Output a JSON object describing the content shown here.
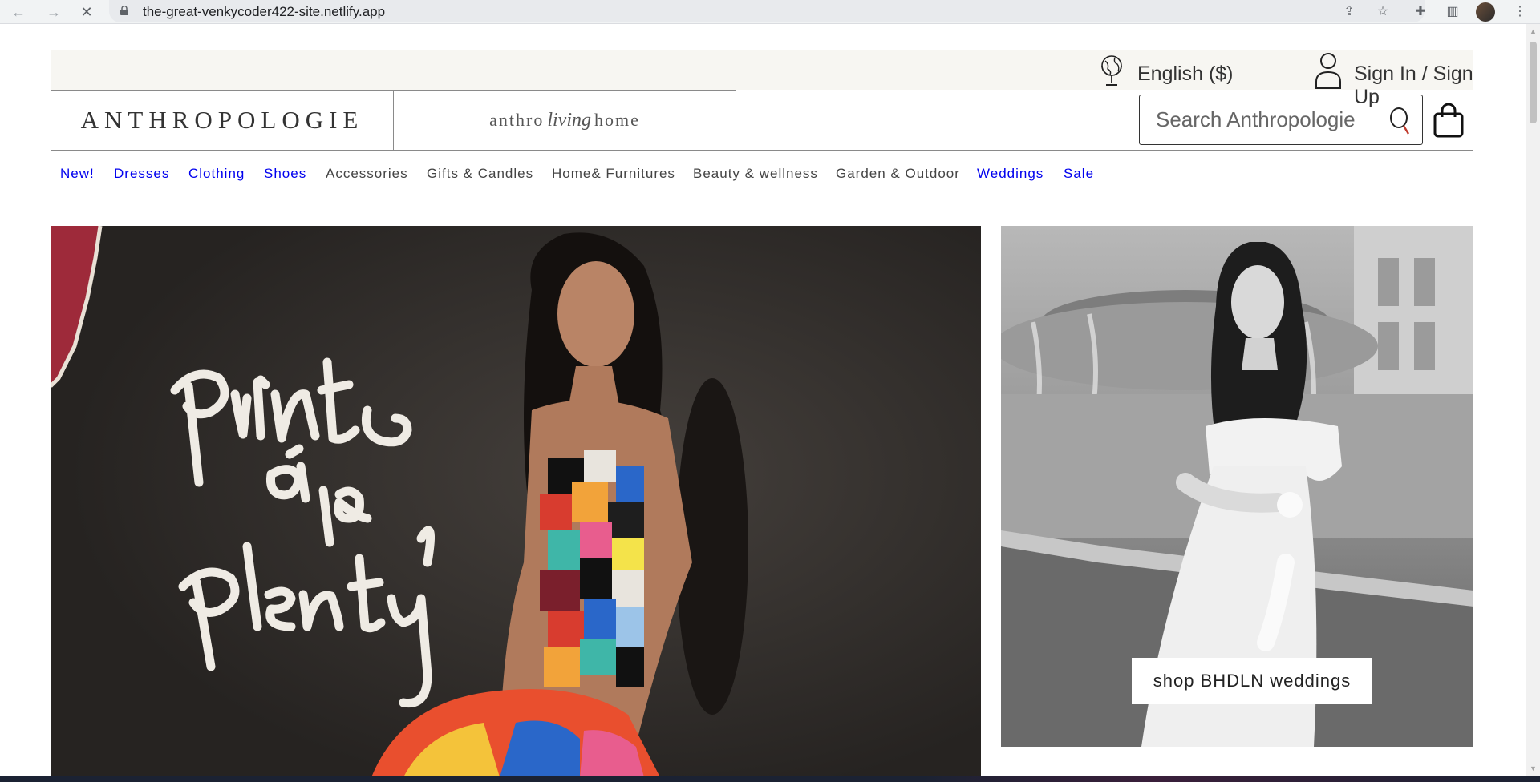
{
  "browser": {
    "url": "the-great-venkycoder422-site.netlify.app"
  },
  "utility": {
    "language": "English ($)",
    "signin": "Sign In / Sign Up"
  },
  "logos": {
    "primary": "ANTHROPOLOGIE",
    "secondary_left": "anthro",
    "secondary_script": "living",
    "secondary_right": "home"
  },
  "search": {
    "placeholder": "Search Anthropologie"
  },
  "nav": {
    "items": [
      {
        "label": "New!"
      },
      {
        "label": "Dresses"
      },
      {
        "label": "Clothing"
      },
      {
        "label": "Shoes"
      },
      {
        "label": "Accessories"
      },
      {
        "label": "Gifts & Candles"
      },
      {
        "label": "Home& Furnitures"
      },
      {
        "label": "Beauty & wellness"
      },
      {
        "label": "Garden & Outdoor"
      },
      {
        "label": "Weddings"
      },
      {
        "label": "Sale"
      }
    ]
  },
  "hero": {
    "script_line1": "prints",
    "script_line2": "à la",
    "script_line3": "plenty",
    "wedding_cta": "shop BHDLN weddings"
  },
  "colors": {
    "link_blue": "#0000ee",
    "link_dark": "#444444",
    "util_bg": "#f7f6f2"
  }
}
